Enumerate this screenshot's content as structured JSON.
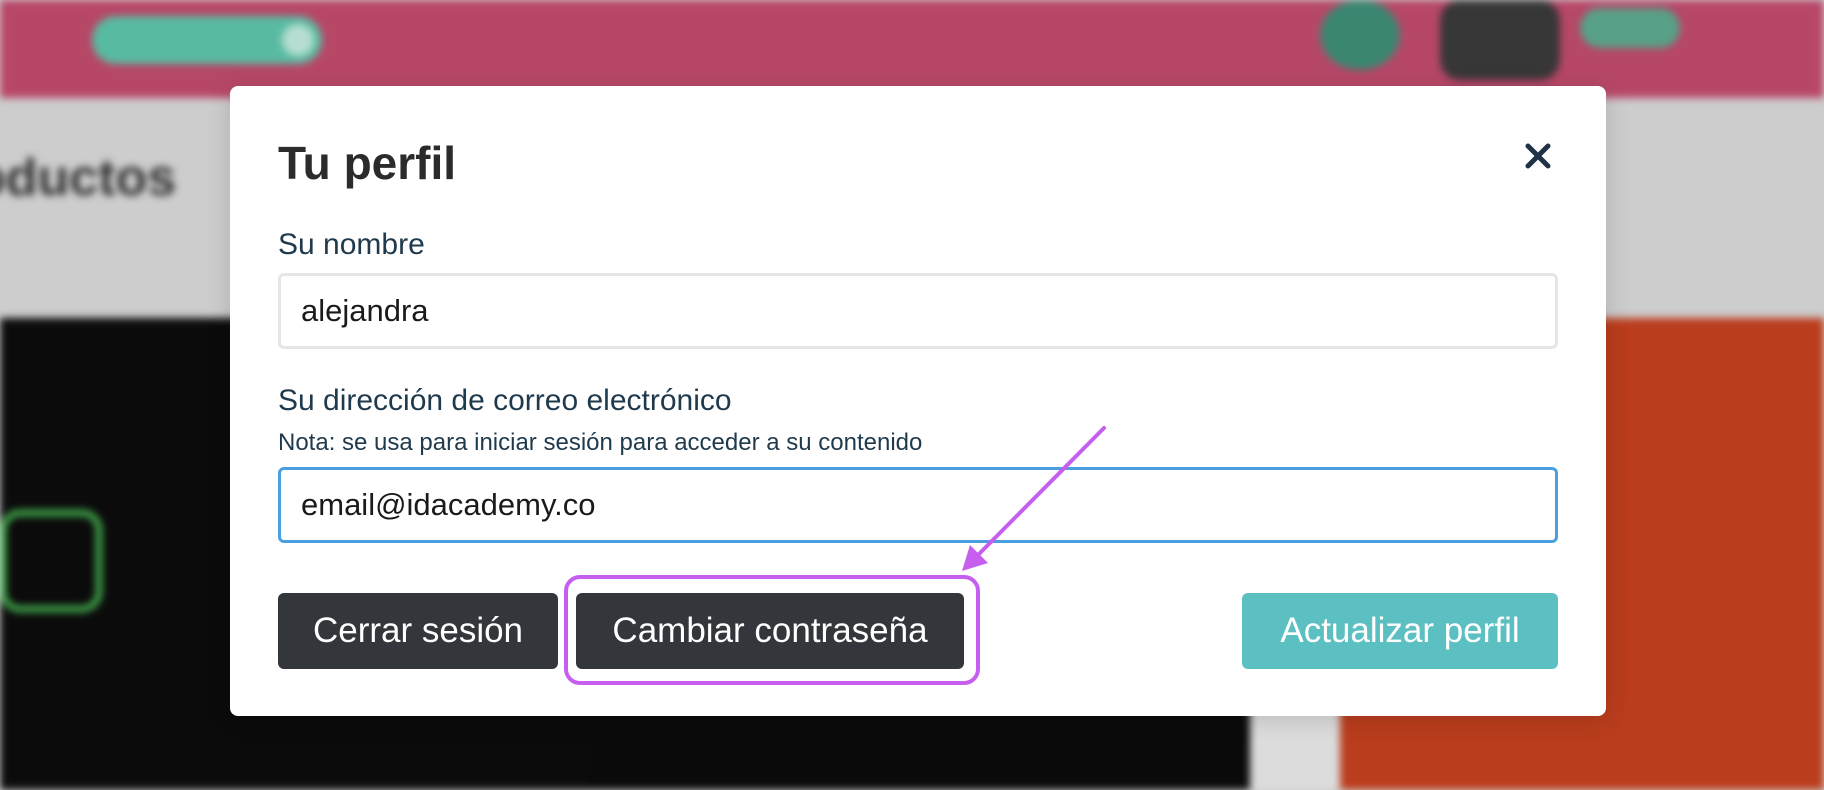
{
  "modal": {
    "title": "Tu perfil",
    "name_label": "Su nombre",
    "name_value": "alejandra",
    "email_label": "Su dirección de correo electrónico",
    "email_note": "Nota: se usa para iniciar sesión para acceder a su contenido",
    "email_value": "email@idacademy.co",
    "logout_label": "Cerrar sesión",
    "change_password_label": "Cambiar contraseña",
    "update_profile_label": "Actualizar perfil"
  },
  "background": {
    "section_title": "oductos"
  },
  "colors": {
    "header_pink": "#bf4a6c",
    "dark_button": "#33363b",
    "teal_button": "#5cc0c2",
    "focus_border": "#4a9fdf",
    "annotation_purple": "#c65ff0"
  },
  "icons": {
    "close": "close-icon",
    "annotation_arrow": "arrow-icon"
  }
}
